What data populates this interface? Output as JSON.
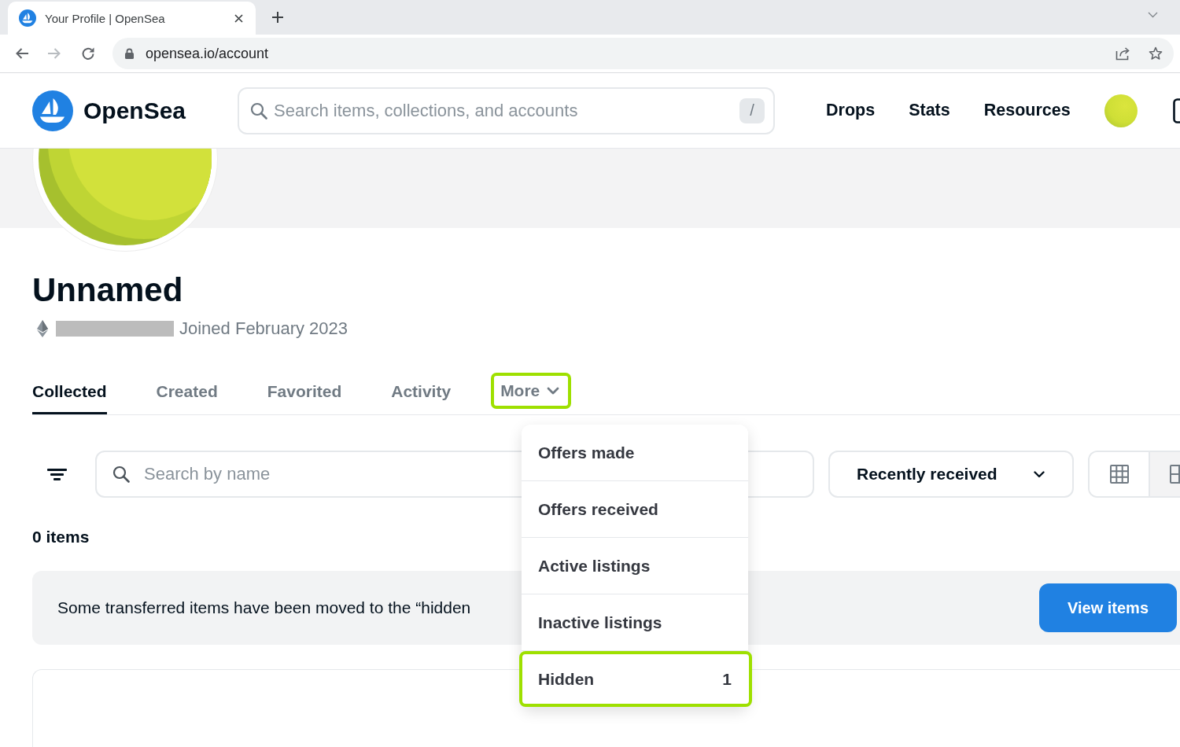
{
  "browser": {
    "tab": {
      "title": "Your Profile | OpenSea"
    },
    "address": {
      "url": "opensea.io/account"
    }
  },
  "header": {
    "brand": "OpenSea",
    "search": {
      "placeholder": "Search items, collections, and accounts",
      "shortcut": "/"
    },
    "nav": [
      {
        "label": "Drops"
      },
      {
        "label": "Stats"
      },
      {
        "label": "Resources"
      }
    ]
  },
  "profile": {
    "name": "Unnamed",
    "joined": "Joined February 2023"
  },
  "tabs": [
    {
      "label": "Collected",
      "kind": "tab",
      "selected": true,
      "highlighted": false
    },
    {
      "label": "Created",
      "kind": "tab",
      "selected": false,
      "highlighted": false
    },
    {
      "label": "Favorited",
      "kind": "tab",
      "selected": false,
      "highlighted": false
    },
    {
      "label": "Activity",
      "kind": "tab",
      "selected": false,
      "highlighted": false
    },
    {
      "label": "More",
      "kind": "dropdown",
      "selected": false,
      "highlighted": true
    }
  ],
  "toolbar": {
    "search": {
      "placeholder": "Search by name"
    },
    "sort": {
      "label": "Recently received"
    },
    "view_options": [
      {
        "kind": "compact",
        "selected": false
      },
      {
        "kind": "large",
        "selected": true
      }
    ]
  },
  "results": {
    "count": "0 items",
    "notice": {
      "text": "Some transferred items have been moved to the “hidden",
      "button": "View items"
    }
  },
  "menu": {
    "items": [
      {
        "label": "Offers made",
        "highlighted": false
      },
      {
        "label": "Offers received",
        "highlighted": false
      },
      {
        "label": "Active listings",
        "highlighted": false
      },
      {
        "label": "Inactive listings",
        "highlighted": false
      },
      {
        "label": "Hidden",
        "count": "1",
        "highlighted": true
      }
    ]
  }
}
